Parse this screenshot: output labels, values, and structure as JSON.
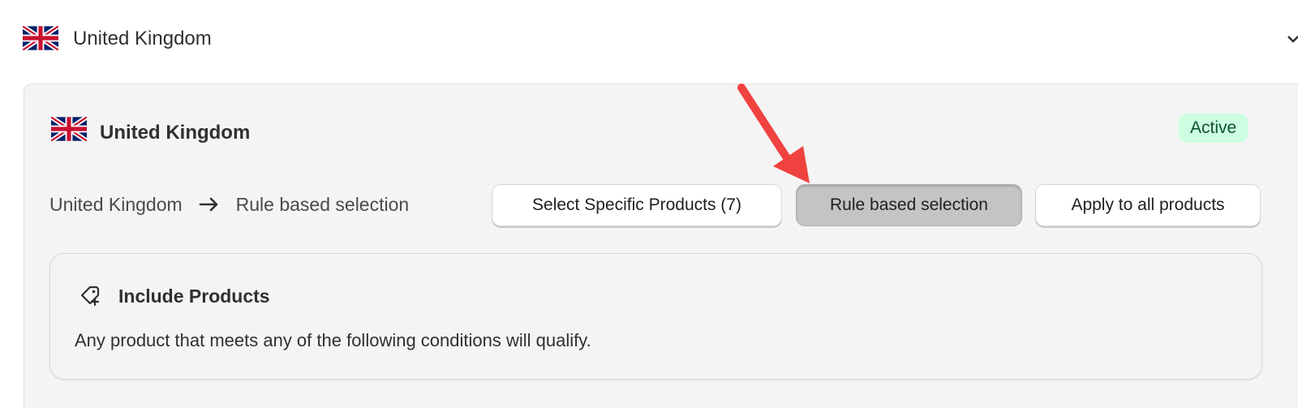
{
  "header": {
    "country": "United Kingdom",
    "flag_icon": "uk-flag-icon",
    "chevron_icon": "chevron-down-icon"
  },
  "card": {
    "country": "United Kingdom",
    "status_badge": "Active",
    "badge_bg": "#cdfee1",
    "badge_color": "#0c5132",
    "breadcrumb": {
      "from": "United Kingdom",
      "arrow_icon": "arrow-right-icon",
      "to": "Rule based selection"
    },
    "selection_options": [
      {
        "label": "Select Specific Products (7)",
        "selected": false
      },
      {
        "label": "Rule based selection",
        "selected": true
      },
      {
        "label": "Apply to all products",
        "selected": false
      }
    ],
    "include": {
      "icon": "tag-plus-icon",
      "title": "Include Products",
      "description": "Any product that meets any of the following conditions will qualify."
    }
  },
  "annotation": {
    "arrow_color": "#f0423f"
  }
}
